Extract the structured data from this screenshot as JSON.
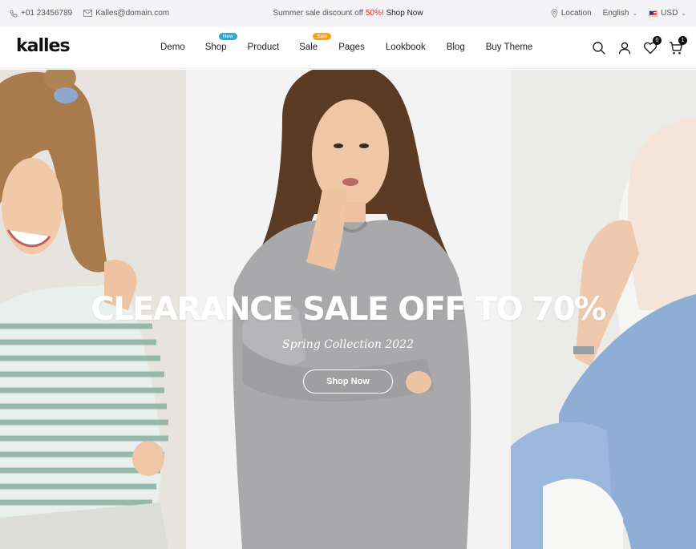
{
  "topbar": {
    "phone": "+01 23456789",
    "email": "Kalles@domain.com",
    "promo_text": "Summer sale discount off ",
    "promo_percent": "50%!",
    "promo_link": "Shop Now",
    "location": "Location",
    "language": "English",
    "currency": "USD"
  },
  "header": {
    "logo": "kalles",
    "nav": [
      {
        "label": "Demo"
      },
      {
        "label": "Shop",
        "badge": "New"
      },
      {
        "label": "Product"
      },
      {
        "label": "Sale",
        "badge": "Sale"
      },
      {
        "label": "Pages"
      },
      {
        "label": "Lookbook"
      },
      {
        "label": "Blog"
      },
      {
        "label": "Buy Theme"
      }
    ],
    "wishlist_count": "0",
    "cart_count": "1"
  },
  "hero": {
    "title": "CLEARANCE SALE OFF TO 70%",
    "subtitle": "Spring Collection 2022",
    "button_label": "Shop Now"
  },
  "colors": {
    "accent_red": "#e02b2b",
    "badge_new": "#2fa7d6",
    "badge_sale": "#f4a51c"
  }
}
